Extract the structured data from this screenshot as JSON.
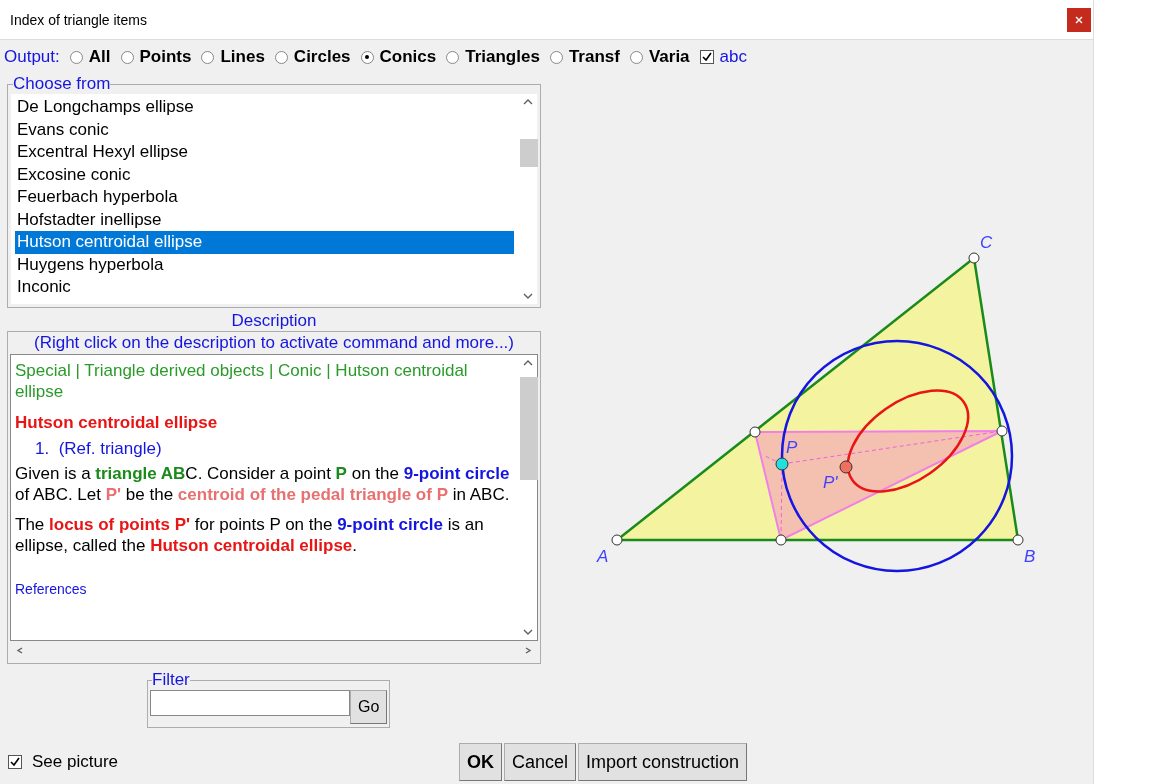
{
  "window": {
    "title": "Index of triangle items"
  },
  "output": {
    "label": "Output:",
    "options": [
      {
        "label": "All",
        "selected": false
      },
      {
        "label": "Points",
        "selected": false
      },
      {
        "label": "Lines",
        "selected": false
      },
      {
        "label": "Circles",
        "selected": false
      },
      {
        "label": "Conics",
        "selected": true
      },
      {
        "label": "Triangles",
        "selected": false
      },
      {
        "label": "Transf",
        "selected": false
      },
      {
        "label": "Varia",
        "selected": false
      }
    ],
    "abc": {
      "label": "abc",
      "checked": true
    }
  },
  "choose_from": {
    "title": "Choose from",
    "items": [
      {
        "label": "De Longchamps ellipse",
        "selected": false
      },
      {
        "label": "Evans conic",
        "selected": false
      },
      {
        "label": "Excentral Hexyl ellipse",
        "selected": false
      },
      {
        "label": "Excosine conic",
        "selected": false
      },
      {
        "label": "Feuerbach hyperbola",
        "selected": false
      },
      {
        "label": "Hofstadter inellipse",
        "selected": false
      },
      {
        "label": "Hutson centroidal ellipse",
        "selected": true
      },
      {
        "label": "Huygens hyperbola",
        "selected": false
      },
      {
        "label": "Inconic",
        "selected": false
      }
    ]
  },
  "description": {
    "title": "Description",
    "hint": "(Right click on the description to activate command and more...)",
    "breadcrumb": "Special | Triangle derived objects | Conic | Hutson centroidal ellipse",
    "heading": "Hutson centroidal ellipse",
    "numbered": {
      "number": "1.",
      "text": "(Ref. triangle)"
    },
    "paragraphs": [
      [
        {
          "text": "Given is a "
        },
        {
          "text": "triangle AB",
          "color": "#1a8a1a"
        },
        {
          "text": "C. Consider a point "
        },
        {
          "text": "P",
          "color": "#1a8a1a"
        },
        {
          "text": " on the "
        },
        {
          "text": "9-point circle",
          "color": "#1515e0"
        },
        {
          "text": " of ABC. Let "
        },
        {
          "text": "P'",
          "color": "#e87070"
        },
        {
          "text": " be the "
        },
        {
          "text": "centroid of the pedal triangle of P",
          "color": "#e87070"
        },
        {
          "text": " in ABC."
        }
      ],
      [
        {
          "text": "The "
        },
        {
          "text": "locus of points P'",
          "color": "#e81515"
        },
        {
          "text": " for points P on the "
        },
        {
          "text": "9-point circle",
          "color": "#1515e0"
        },
        {
          "text": " is an ellipse, called the "
        },
        {
          "text": "Hutson centroidal ellipse",
          "color": "#e81515"
        },
        {
          "text": "."
        }
      ]
    ],
    "link": "References"
  },
  "filter": {
    "title": "Filter",
    "button": "Go"
  },
  "see_picture": {
    "label": "See picture",
    "checked": true
  },
  "figure": {
    "labels": [
      "A",
      "B",
      "C",
      "P",
      "P'"
    ]
  },
  "buttons": [
    {
      "label": "OK",
      "default": true
    },
    {
      "label": "Cancel",
      "default": false
    },
    {
      "label": "Import construction",
      "default": false
    }
  ]
}
